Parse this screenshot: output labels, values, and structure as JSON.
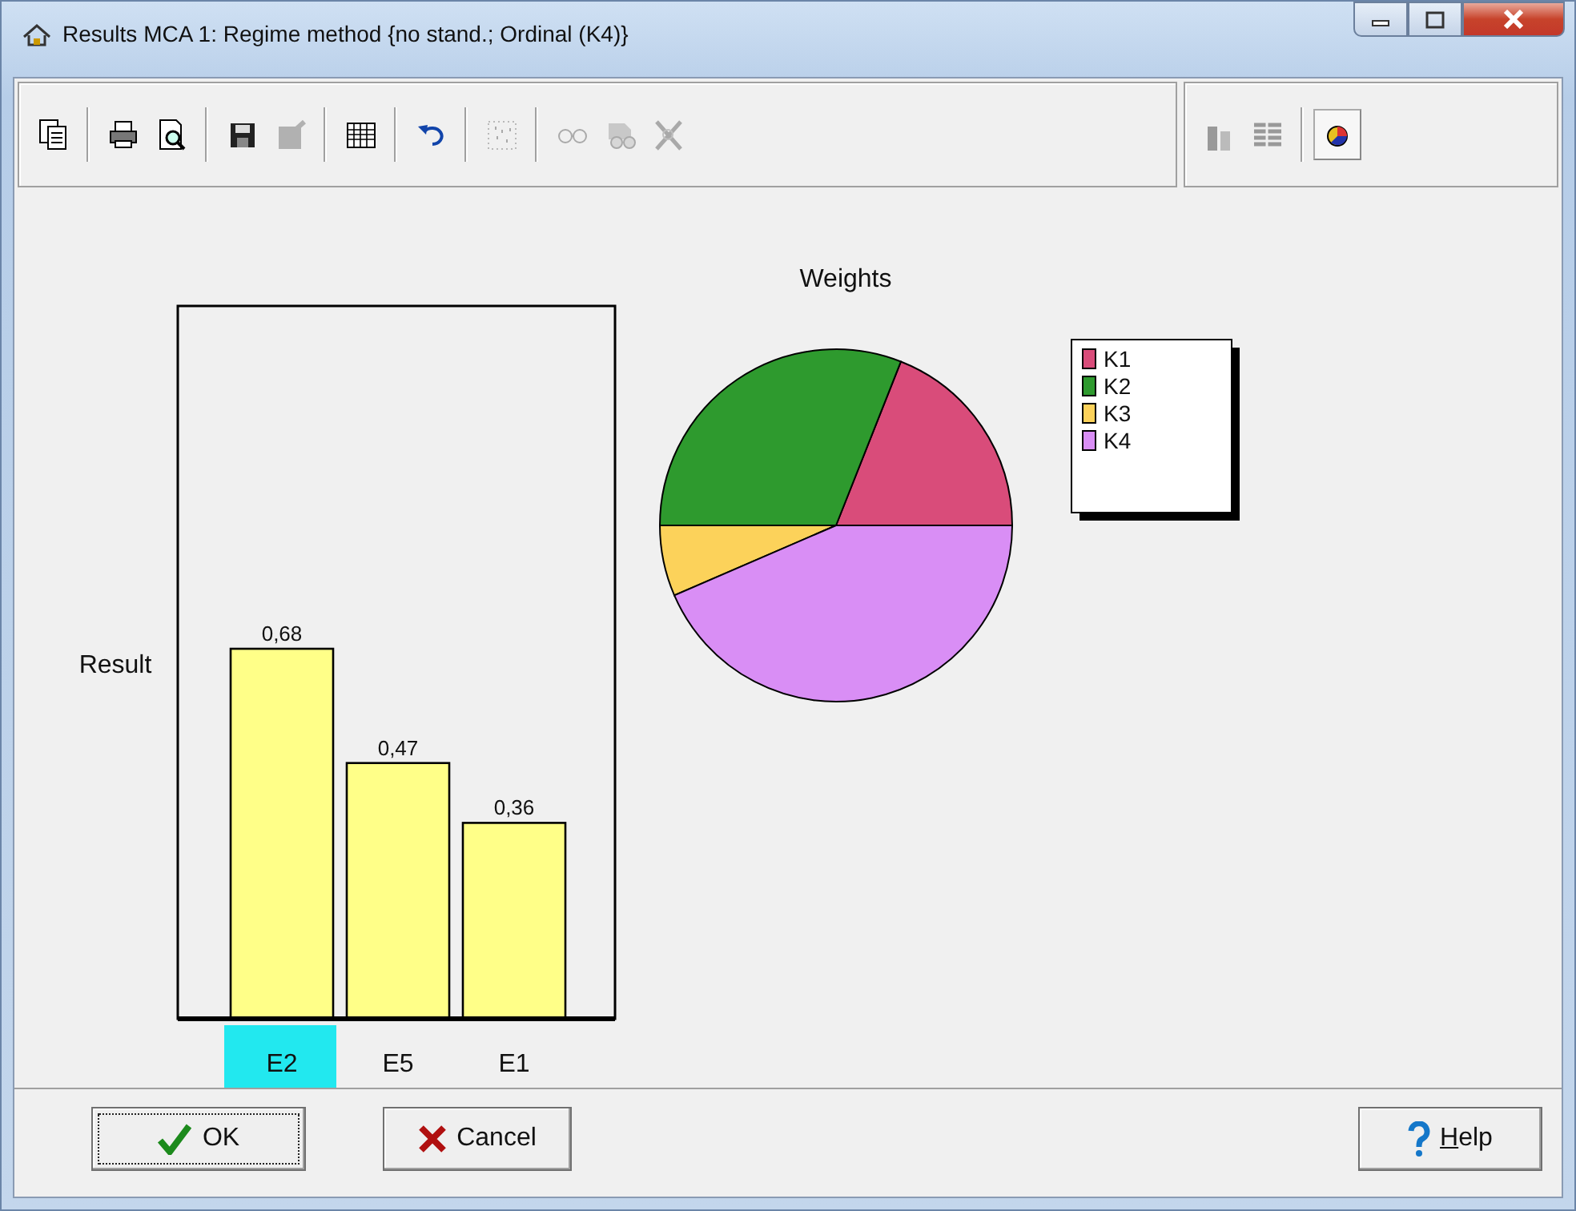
{
  "window": {
    "title": "Results MCA 1: Regime method {no stand.; Ordinal (K4)}"
  },
  "toolbar_groups": [
    [
      {
        "kind": "copy",
        "disabled": false
      }
    ],
    [
      {
        "kind": "print",
        "disabled": false
      },
      {
        "kind": "preview",
        "disabled": false
      }
    ],
    [
      {
        "kind": "save",
        "disabled": false
      },
      {
        "kind": "export",
        "disabled": true
      }
    ],
    [
      {
        "kind": "grid",
        "disabled": false
      }
    ],
    [
      {
        "kind": "undo",
        "disabled": false
      }
    ],
    [
      {
        "kind": "scatter",
        "disabled": true
      }
    ],
    [
      {
        "kind": "glasses",
        "disabled": true
      },
      {
        "kind": "glasses-stack",
        "disabled": true
      },
      {
        "kind": "cross",
        "disabled": true
      }
    ]
  ],
  "view_groups": [
    [
      {
        "kind": "bars",
        "selected": false
      },
      {
        "kind": "lines",
        "selected": false
      }
    ],
    [
      {
        "kind": "pie",
        "selected": true
      }
    ]
  ],
  "bar_chart": {
    "chart_data": {
      "type": "bar",
      "ylabel": "Result",
      "categories": [
        "E2",
        "E5",
        "E1"
      ],
      "values": [
        0.68,
        0.47,
        0.36
      ],
      "value_labels": [
        "0,68",
        "0,47",
        "0,36"
      ],
      "ylim": [
        0,
        1.31
      ]
    },
    "category_states": [
      {
        "selected": true
      },
      {
        "selected": false
      },
      {
        "selected": false
      }
    ]
  },
  "pie": {
    "title": "Weights",
    "legend": [
      {
        "label": "K1",
        "color": "#d94c7a"
      },
      {
        "label": "K2",
        "color": "#2e9a2e"
      },
      {
        "label": "K3",
        "color": "#fcd25a"
      },
      {
        "label": "K4",
        "color": "#d98ef5"
      }
    ]
  },
  "buttons": [
    {
      "kind": "ok",
      "label": "OK",
      "focused": true,
      "mnemonic": false
    },
    {
      "kind": "cancel",
      "label": "Cancel",
      "focused": false,
      "mnemonic": false
    },
    {
      "kind": "help",
      "label": "Help",
      "focused": false,
      "mnemonic": true
    }
  ]
}
